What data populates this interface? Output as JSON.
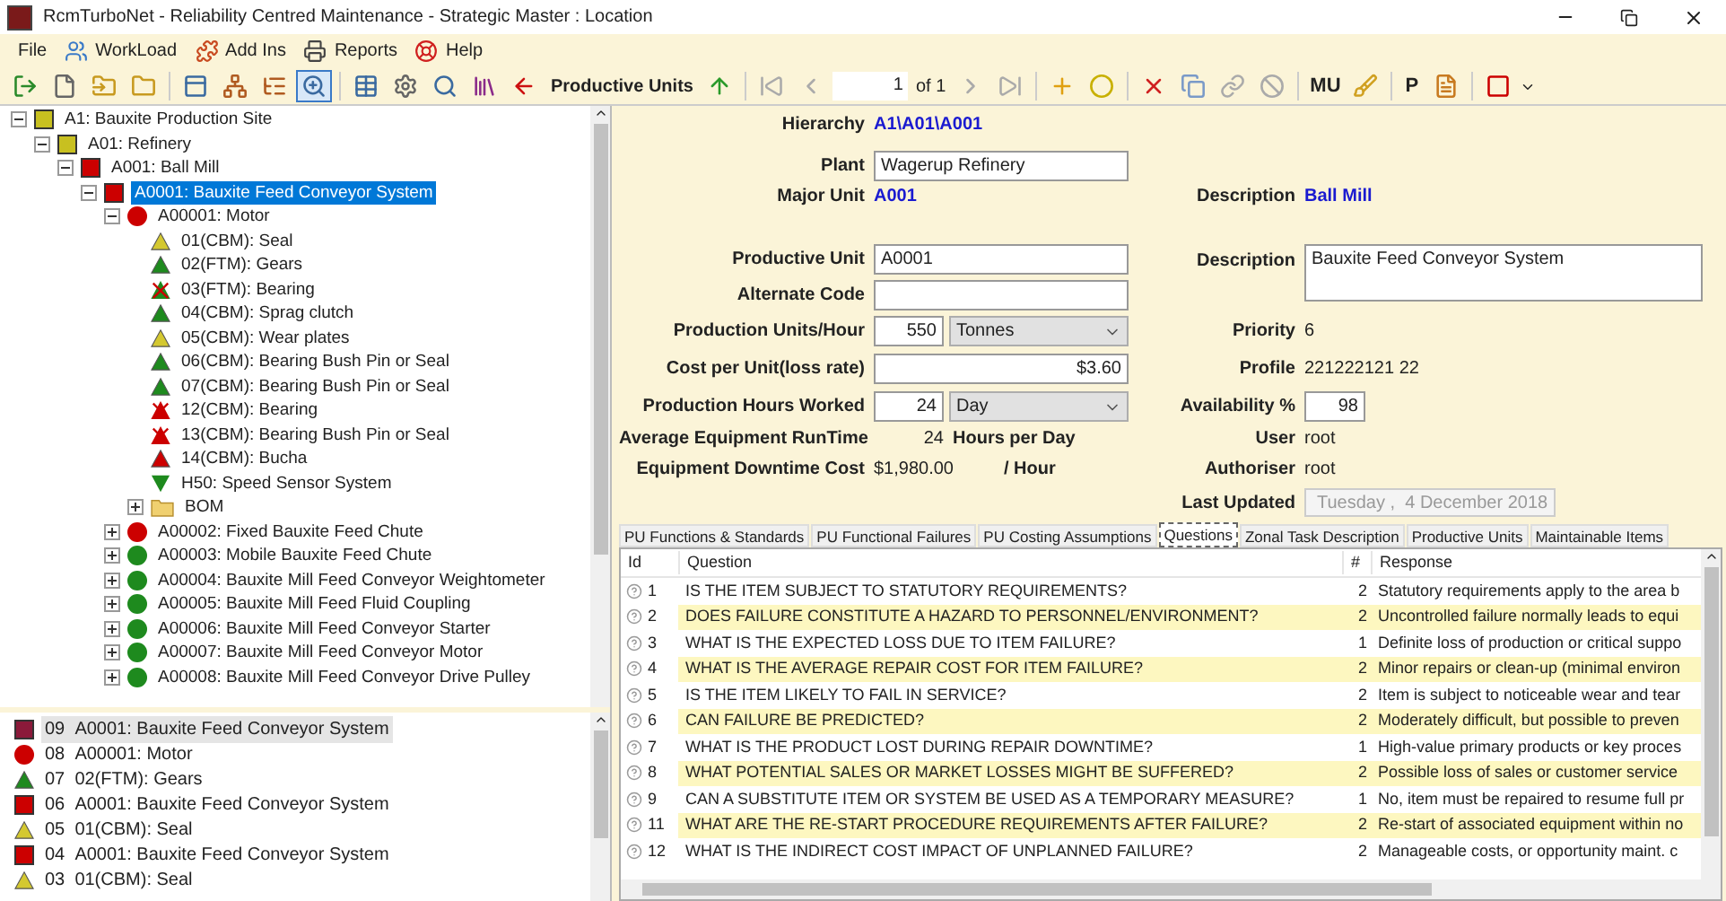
{
  "window": {
    "title": "RcmTurboNet - Reliability Centred Maintenance - Strategic Master : Location"
  },
  "menu": [
    {
      "label": "File",
      "kind": "plain"
    },
    {
      "label": "WorkLoad",
      "kind": "workload"
    },
    {
      "label": "Add Ins",
      "kind": "addins"
    },
    {
      "label": "Reports",
      "kind": "reports"
    },
    {
      "label": "Help",
      "kind": "help"
    }
  ],
  "toolbar": {
    "label": "Productive Units",
    "page": "1",
    "page_of": "of 1",
    "mu": "MU",
    "p": "P",
    "magnifier_pressed": true
  },
  "tree": [
    {
      "label": "A1: Bauxite Production Site",
      "kind": "square",
      "color": "#c8c020",
      "expanded": true,
      "selected": false,
      "children": [
        {
          "label": "A01: Refinery",
          "kind": "square",
          "color": "#c8c020",
          "expanded": true,
          "selected": false,
          "children": [
            {
              "label": "A001: Ball Mill",
              "kind": "square",
              "color": "#cc0000",
              "expanded": true,
              "selected": false,
              "children": [
                {
                  "label": "A0001: Bauxite Feed Conveyor System",
                  "kind": "square",
                  "color": "#cc0000",
                  "expanded": true,
                  "selected": true,
                  "children": [
                    {
                      "label": "A00001: Motor",
                      "kind": "circle",
                      "color": "#cc0000",
                      "expanded": true,
                      "selected": false,
                      "children": [
                        {
                          "label": "01(CBM): Seal",
                          "kind": "triangle",
                          "color": "#d4c830",
                          "selected": false
                        },
                        {
                          "label": "02(FTM): Gears",
                          "kind": "triangle",
                          "color": "#1e8a1e",
                          "selected": false
                        },
                        {
                          "label": "03(FTM): Bearing",
                          "kind": "crossed",
                          "color": "#1e8a1e",
                          "selected": false
                        },
                        {
                          "label": "04(CBM): Sprag clutch",
                          "kind": "triangle",
                          "color": "#1e8a1e",
                          "selected": false
                        },
                        {
                          "label": "05(CBM): Wear plates",
                          "kind": "triangle",
                          "color": "#d4c830",
                          "selected": false
                        },
                        {
                          "label": "06(CBM): Bearing Bush Pin or Seal",
                          "kind": "triangle",
                          "color": "#1e8a1e",
                          "selected": false
                        },
                        {
                          "label": "07(CBM): Bearing Bush Pin or Seal",
                          "kind": "triangle",
                          "color": "#1e8a1e",
                          "selected": false
                        },
                        {
                          "label": "12(CBM): Bearing",
                          "kind": "crossed",
                          "color": "#cc0000",
                          "selected": false
                        },
                        {
                          "label": "13(CBM): Bearing Bush Pin or Seal",
                          "kind": "crossed",
                          "color": "#cc0000",
                          "selected": false
                        },
                        {
                          "label": "14(CBM): Bucha",
                          "kind": "triangle",
                          "color": "#cc0000",
                          "selected": false
                        },
                        {
                          "label": "H50: Speed Sensor System",
                          "kind": "triangle-down",
                          "color": "#1e8a1e",
                          "selected": false
                        },
                        {
                          "label": "BOM",
                          "kind": "folder",
                          "color": "#f0d070",
                          "expanded": false,
                          "selected": false
                        }
                      ]
                    },
                    {
                      "label": "A00002: Fixed Bauxite Feed Chute",
                      "kind": "circle",
                      "color": "#cc0000",
                      "expanded": false,
                      "selected": false
                    },
                    {
                      "label": "A00003: Mobile Bauxite Feed Chute",
                      "kind": "circle",
                      "color": "#1e8a1e",
                      "expanded": false,
                      "selected": false
                    },
                    {
                      "label": "A00004: Bauxite Mill Feed Conveyor Weightometer",
                      "kind": "circle",
                      "color": "#1e8a1e",
                      "expanded": false,
                      "selected": false
                    },
                    {
                      "label": "A00005: Bauxite Mill Feed Fluid Coupling",
                      "kind": "circle",
                      "color": "#1e8a1e",
                      "expanded": false,
                      "selected": false
                    },
                    {
                      "label": "A00006: Bauxite Mill Feed Conveyor Starter",
                      "kind": "circle",
                      "color": "#1e8a1e",
                      "expanded": false,
                      "selected": false
                    },
                    {
                      "label": "A00007: Bauxite Mill Feed Conveyor Motor",
                      "kind": "circle",
                      "color": "#1e8a1e",
                      "expanded": false,
                      "selected": false
                    },
                    {
                      "label": "A00008: Bauxite Mill Feed Conveyor Drive Pulley",
                      "kind": "circle",
                      "color": "#1e8a1e",
                      "expanded": false,
                      "selected": false
                    }
                  ]
                }
              ]
            }
          ]
        }
      ]
    }
  ],
  "history": [
    {
      "number": "09",
      "label": "A0001: Bauxite Feed Conveyor System",
      "kind": "square",
      "color": "#8b1a3a",
      "selected": true
    },
    {
      "number": "08",
      "label": "A00001: Motor",
      "kind": "circle",
      "color": "#cc0000",
      "selected": false
    },
    {
      "number": "07",
      "label": "02(FTM): Gears",
      "kind": "triangle",
      "color": "#1e8a1e",
      "selected": false
    },
    {
      "number": "06",
      "label": "A0001: Bauxite Feed Conveyor System",
      "kind": "square",
      "color": "#cc0000",
      "selected": false
    },
    {
      "number": "05",
      "label": "01(CBM): Seal",
      "kind": "triangle",
      "color": "#d4c830",
      "selected": false
    },
    {
      "number": "04",
      "label": "A0001: Bauxite Feed Conveyor System",
      "kind": "square",
      "color": "#cc0000",
      "selected": false
    },
    {
      "number": "03",
      "label": "01(CBM): Seal",
      "kind": "triangle",
      "color": "#d4c830",
      "selected": false
    }
  ],
  "form": {
    "hierarchy": {
      "label": "Hierarchy",
      "value": "A1\\A01\\A001"
    },
    "plant": {
      "label": "Plant",
      "value": "Wagerup Refinery"
    },
    "major_unit": {
      "label": "Major Unit",
      "value": "A001"
    },
    "major_description": {
      "label": "Description",
      "value": "Ball Mill"
    },
    "productive_unit": {
      "label": "Productive Unit",
      "value": "A0001"
    },
    "pu_description": {
      "label": "Description",
      "value": "Bauxite Feed Conveyor System"
    },
    "alternate_code": {
      "label": "Alternate Code"
    },
    "production_units": {
      "label": "Production Units/Hour",
      "value": "550",
      "unit": "Tonnes"
    },
    "priority": {
      "label": "Priority",
      "value": "6"
    },
    "cost_per_unit": {
      "label": "Cost per Unit(loss rate)",
      "value": "$3.60"
    },
    "profile": {
      "label": "Profile",
      "value": "221222121 22"
    },
    "hours_worked": {
      "label": "Production Hours Worked",
      "value": "24",
      "unit": "Day"
    },
    "availability": {
      "label": "Availability %",
      "value": "98"
    },
    "runtime": {
      "label": "Average Equipment RunTime",
      "value": "24",
      "unit": "Hours per Day"
    },
    "user": {
      "label": "User",
      "value": "root"
    },
    "downtime_cost": {
      "label": "Equipment Downtime Cost",
      "value": "$1,980.00",
      "unit": "/ Hour"
    },
    "authoriser": {
      "label": "Authoriser",
      "value": "root"
    },
    "last_updated": {
      "label": "Last Updated",
      "day": "Tuesday",
      "separator": ",",
      "date": "4 December 2018",
      "disabled": true
    }
  },
  "tabs": [
    {
      "label": "PU Functions & Standards",
      "selected": false
    },
    {
      "label": "PU Functional Failures",
      "selected": false
    },
    {
      "label": "PU Costing Assumptions",
      "selected": false
    },
    {
      "label": "Questions",
      "selected": true
    },
    {
      "label": "Zonal Task Description",
      "selected": false
    },
    {
      "label": "Productive Units",
      "selected": false
    },
    {
      "label": "Maintainable Items",
      "selected": false
    }
  ],
  "table": {
    "columns": [
      "Id",
      "Question",
      "#",
      "Response"
    ],
    "rows": [
      {
        "id": "1",
        "question": "IS THE ITEM SUBJECT TO STATUTORY REQUIREMENTS?",
        "count": "2",
        "response": "Statutory requirements apply to the area b"
      },
      {
        "id": "2",
        "question": "DOES FAILURE CONSTITUTE A HAZARD TO PERSONNEL/ENVIRONMENT?",
        "count": "2",
        "response": "Uncontrolled failure normally leads to equi"
      },
      {
        "id": "3",
        "question": "WHAT IS THE EXPECTED LOSS DUE TO ITEM FAILURE?",
        "count": "1",
        "response": "Definite loss of production or critical suppo"
      },
      {
        "id": "4",
        "question": "WHAT IS THE AVERAGE REPAIR COST FOR ITEM FAILURE?",
        "count": "2",
        "response": "Minor repairs or clean-up (minimal environ"
      },
      {
        "id": "5",
        "question": "IS THE ITEM LIKELY TO FAIL IN SERVICE?",
        "count": "2",
        "response": "Item is subject to noticeable wear and tear"
      },
      {
        "id": "6",
        "question": "CAN FAILURE BE PREDICTED?",
        "count": "2",
        "response": "Moderately difficult, but possible to preven"
      },
      {
        "id": "7",
        "question": "WHAT IS THE PRODUCT LOST DURING REPAIR DOWNTIME?",
        "count": "1",
        "response": "High-value primary products or key proces"
      },
      {
        "id": "8",
        "question": "WHAT POTENTIAL SALES OR MARKET LOSSES MIGHT BE SUFFERED?",
        "count": "2",
        "response": "Possible loss of sales or customer service"
      },
      {
        "id": "9",
        "question": "CAN A SUBSTITUTE ITEM OR SYSTEM BE USED AS A TEMPORARY MEASURE?",
        "count": "1",
        "response": "No, item must be repaired to resume full pr"
      },
      {
        "id": "11",
        "question": "WHAT ARE THE RE-START PROCEDURE REQUIREMENTS AFTER FAILURE?",
        "count": "2",
        "response": "Re-start of associated equipment within no"
      },
      {
        "id": "12",
        "question": "WHAT IS THE INDIRECT COST IMPACT OF UNPLANNED FAILURE?",
        "count": "2",
        "response": "Manageable costs, or opportunity maint. c"
      }
    ]
  }
}
